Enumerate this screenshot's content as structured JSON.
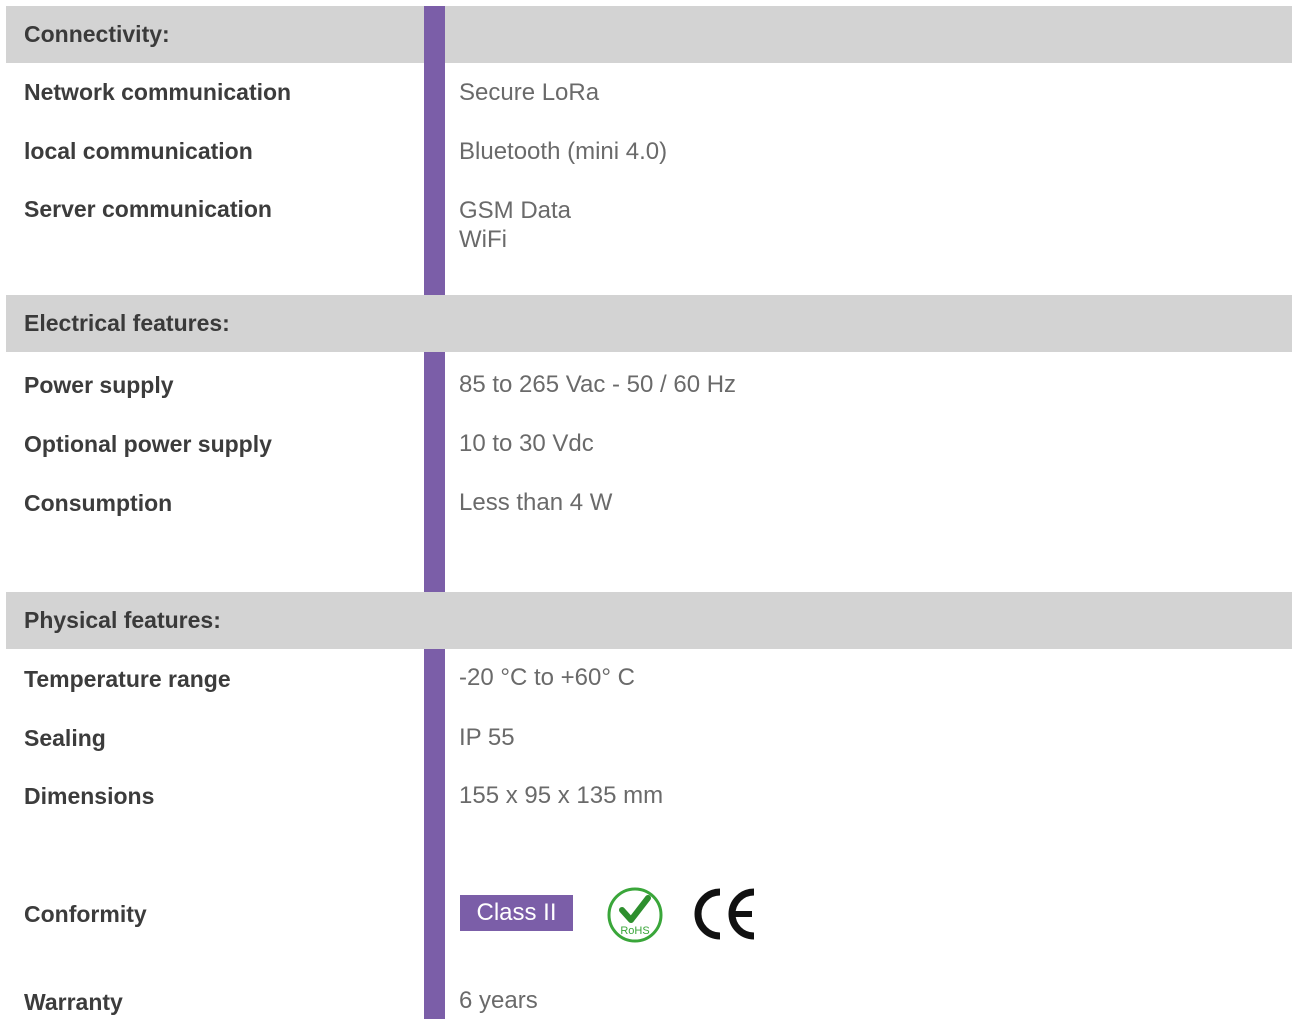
{
  "sections": [
    {
      "title": "Connectivity:",
      "rows": [
        {
          "label": "Network communication",
          "value": "Secure LoRa"
        },
        {
          "label": "local communication",
          "value": "Bluetooth (mini 4.0)"
        },
        {
          "label": "Server communication",
          "value": "GSM Data",
          "value2": "WiFi"
        }
      ]
    },
    {
      "title": "Electrical features:",
      "rows": [
        {
          "label": "Power supply",
          "value": "85 to 265 Vac - 50 / 60 Hz"
        },
        {
          "label": "Optional power supply",
          "value": "10 to 30 Vdc"
        },
        {
          "label": "Consumption",
          "value": "Less than 4 W"
        }
      ]
    },
    {
      "title": "Physical features:",
      "rows": [
        {
          "label": "Temperature range",
          "value": "-20 °C to +60° C"
        },
        {
          "label": "Sealing",
          "value": "IP 55"
        },
        {
          "label": "Dimensions",
          "value": "155 x 95 x 135 mm"
        },
        {
          "label": "Conformity",
          "badge": "Class II",
          "rohs_text": "RoHS",
          "ce_text": "CE"
        },
        {
          "label": "Warranty",
          "value": "6 years"
        }
      ]
    }
  ],
  "colors": {
    "accent": "#7b5ea8",
    "header_bg": "#d3d3d3",
    "rohs_green": "#3aa63a"
  },
  "icons": {
    "rohs": "rohs-checkmark-icon",
    "ce": "ce-mark-icon"
  }
}
